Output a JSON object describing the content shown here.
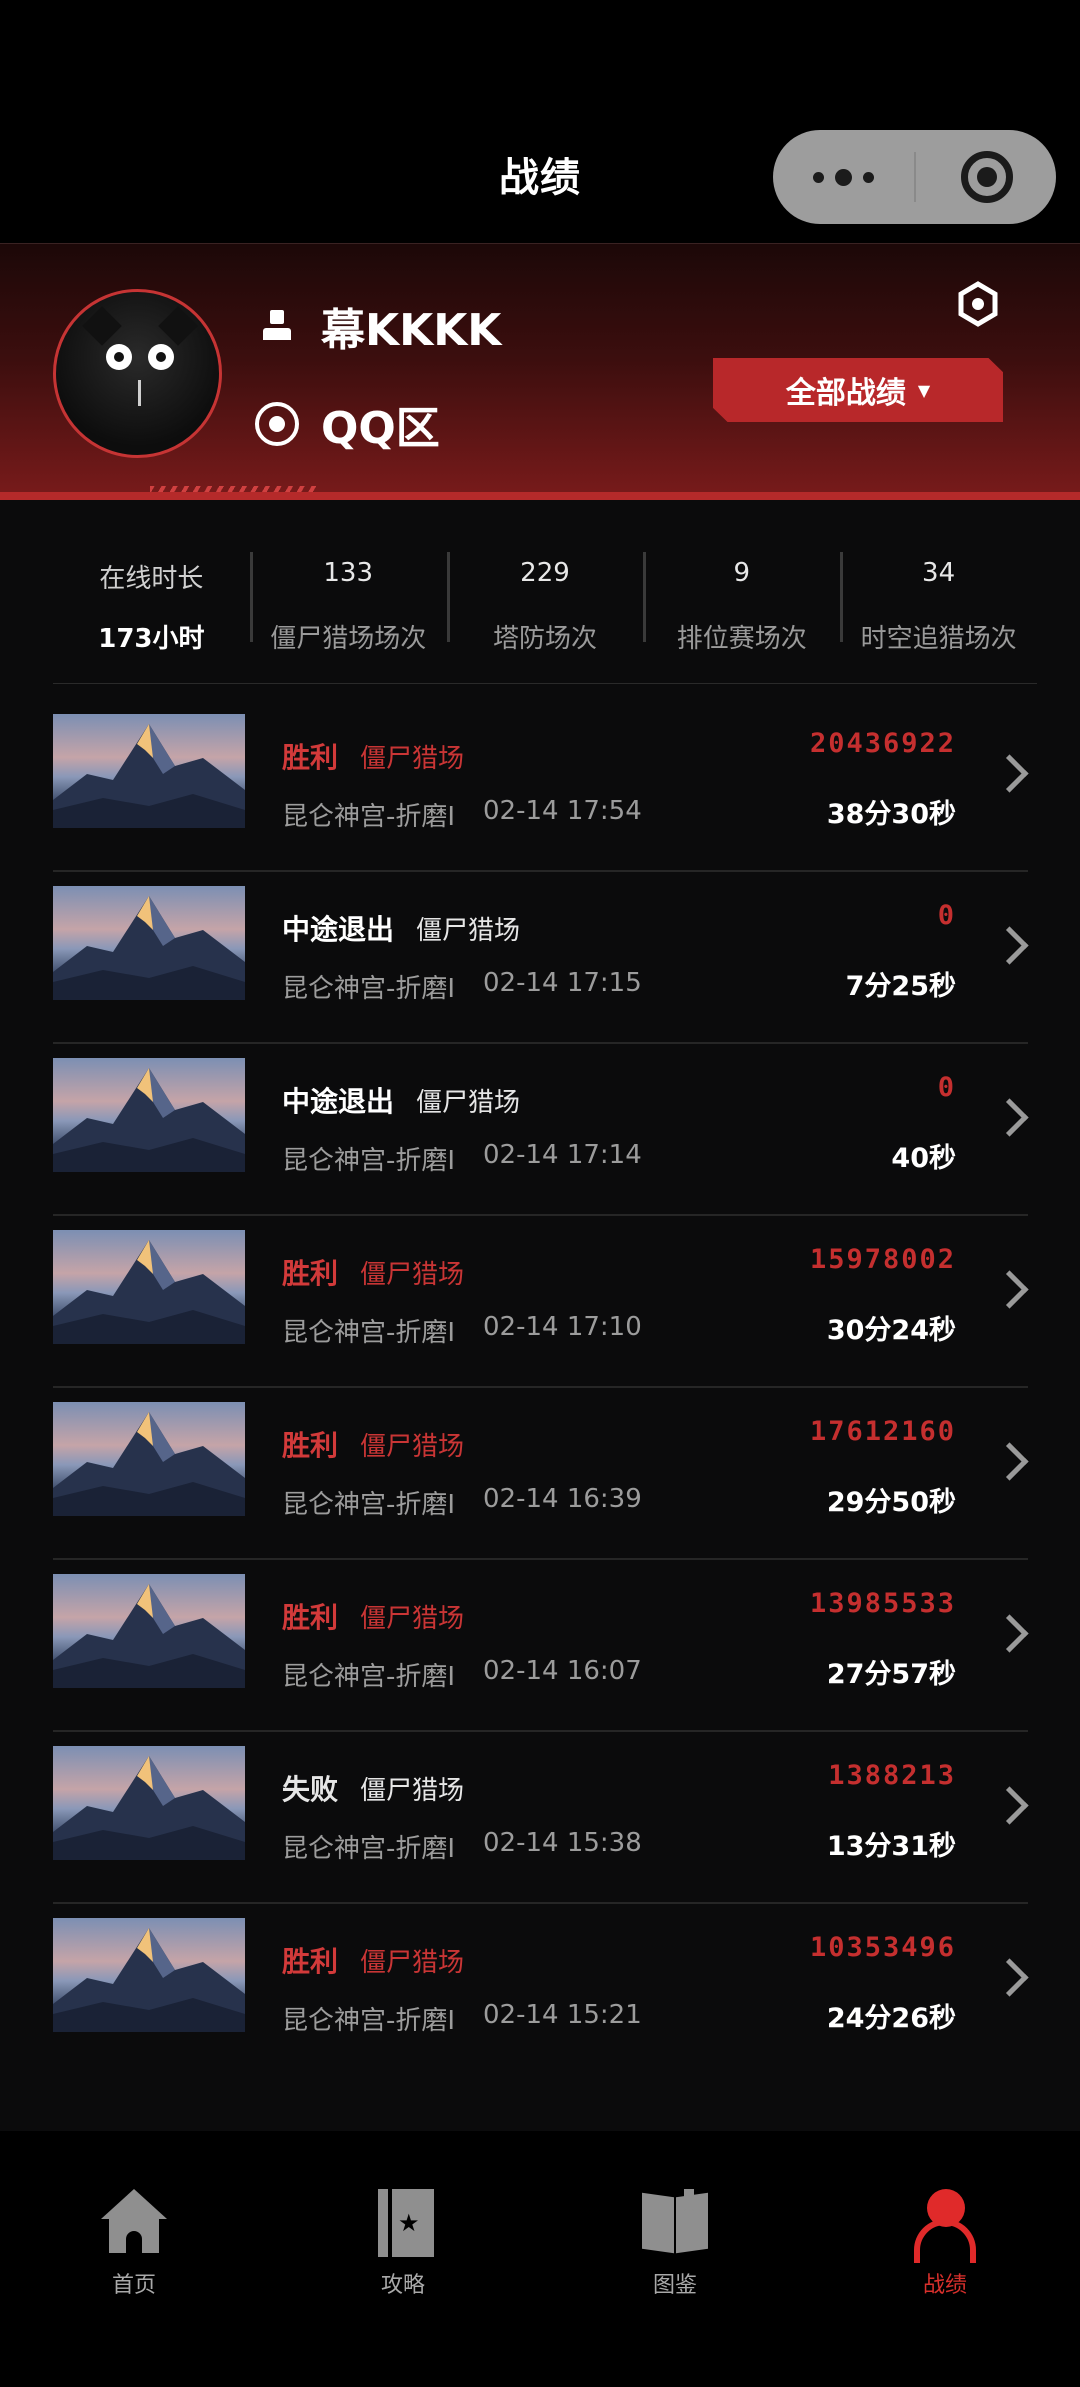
{
  "nav": {
    "title": "战绩"
  },
  "profile": {
    "name": "幕KKKK",
    "zone": "QQ区",
    "filter_label": "全部战绩",
    "filter_caret": "▼"
  },
  "stats": [
    {
      "label": "在线时长",
      "value": "173小时"
    },
    {
      "label": "僵尸猎场场次",
      "value": "133"
    },
    {
      "label": "塔防场次",
      "value": "229"
    },
    {
      "label": "排位赛场次",
      "value": "9"
    },
    {
      "label": "时空追猎场次",
      "value": "34"
    }
  ],
  "records": [
    {
      "result": "胜利",
      "kind": "win",
      "mode": "僵尸猎场",
      "map": "昆仑神宫-折磨I",
      "time": "02-14 17:54",
      "score": "20436922",
      "duration": "38分30秒"
    },
    {
      "result": "中途退出",
      "kind": "neutral",
      "mode": "僵尸猎场",
      "map": "昆仑神宫-折磨I",
      "time": "02-14 17:15",
      "score": "0",
      "duration": "7分25秒"
    },
    {
      "result": "中途退出",
      "kind": "neutral",
      "mode": "僵尸猎场",
      "map": "昆仑神宫-折磨I",
      "time": "02-14 17:14",
      "score": "0",
      "duration": "40秒"
    },
    {
      "result": "胜利",
      "kind": "win",
      "mode": "僵尸猎场",
      "map": "昆仑神宫-折磨I",
      "time": "02-14 17:10",
      "score": "15978002",
      "duration": "30分24秒"
    },
    {
      "result": "胜利",
      "kind": "win",
      "mode": "僵尸猎场",
      "map": "昆仑神宫-折磨I",
      "time": "02-14 16:39",
      "score": "17612160",
      "duration": "29分50秒"
    },
    {
      "result": "胜利",
      "kind": "win",
      "mode": "僵尸猎场",
      "map": "昆仑神宫-折磨I",
      "time": "02-14 16:07",
      "score": "13985533",
      "duration": "27分57秒"
    },
    {
      "result": "失败",
      "kind": "lose",
      "mode": "僵尸猎场",
      "map": "昆仑神宫-折磨I",
      "time": "02-14 15:38",
      "score": "1388213",
      "duration": "13分31秒"
    },
    {
      "result": "胜利",
      "kind": "win",
      "mode": "僵尸猎场",
      "map": "昆仑神宫-折磨I",
      "time": "02-14 15:21",
      "score": "10353496",
      "duration": "24分26秒"
    }
  ],
  "tabs": [
    {
      "label": "首页",
      "icon": "home-icon"
    },
    {
      "label": "攻略",
      "icon": "guide-book-icon"
    },
    {
      "label": "图鉴",
      "icon": "atlas-book-icon"
    },
    {
      "label": "战绩",
      "icon": "profile-icon",
      "active": true
    }
  ],
  "colors": {
    "accent": "#d23a3a",
    "banner": "#7a1b1b",
    "background": "#0b0b0c"
  }
}
